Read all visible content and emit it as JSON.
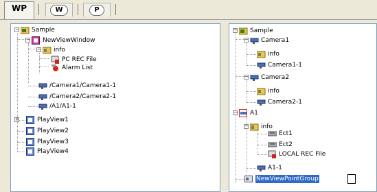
{
  "tabs": [
    {
      "label": "WP",
      "active": true
    },
    {
      "label": "W",
      "active": false
    },
    {
      "label": "P",
      "active": false
    }
  ],
  "left_tree": {
    "root": "Sample",
    "window": "NewViewWindow",
    "info": "info",
    "pc_rec": "PC REC File",
    "alarm": "Alarm List",
    "cam1": "/Camera1/Camera1-1",
    "cam2": "/Camera2/Camera2-1",
    "a1": "/A1/A1-1",
    "pv1": "PlayView1",
    "pv2": "PlayView2",
    "pv3": "PlayView3",
    "pv4": "PlayView4"
  },
  "right_tree": {
    "root": "Sample",
    "camera1": "Camera1",
    "c1_info": "info",
    "c1_sub": "Camera1-1",
    "camera2": "Camera2",
    "c2_info": "info",
    "c2_sub": "Camera2-1",
    "a1": "A1",
    "a1_info": "info",
    "ect1": "Ect1",
    "ect2": "Ect2",
    "local_rec": "LOCAL REC File",
    "a1_sub": "A1-1",
    "new_group": "NewViewPointGroup"
  },
  "colors": {
    "selection": "#316ac5",
    "pane_border": "#7f9db9",
    "folder": "#e8c84a",
    "camera": "#4a6fb8"
  }
}
